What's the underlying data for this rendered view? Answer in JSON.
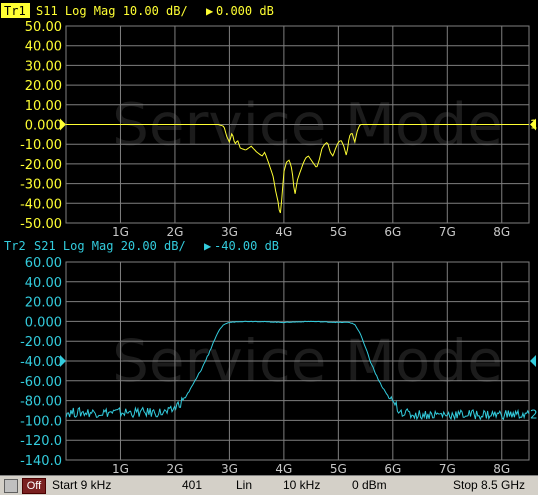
{
  "colors": {
    "trace1": "#ffff33",
    "trace2": "#33ccdd",
    "grid": "#7f7f7f",
    "background": "#000000",
    "watermark": "#1c1c1c"
  },
  "trace1": {
    "tag": "Tr1",
    "label": "S11 Log Mag 10.00 dB/",
    "ref_marker": "▶",
    "ref_value": "0.000 dB",
    "marker_end": "1"
  },
  "trace2": {
    "tag": "Tr2",
    "label": "S21 Log Mag 20.00 dB/",
    "ref_marker": "▶",
    "ref_value": "-40.00 dB",
    "marker_end": "2"
  },
  "watermark": "Service Mode",
  "status": {
    "square_icon": "square-icon",
    "off": "Off",
    "start": "Start 9 kHz",
    "points": "401",
    "sweep_type": "Lin",
    "ifbw": "10 kHz",
    "power": "0 dBm",
    "stop": "Stop 8.5 GHz"
  },
  "chart_data": [
    {
      "type": "line",
      "title": "S11 Log Mag 10.00 dB/",
      "xlabel": "",
      "ylabel": "",
      "x_unit": "GHz",
      "xlim": [
        0,
        8.5
      ],
      "ylim": [
        -50,
        50
      ],
      "yticks": [
        50,
        40,
        30,
        20,
        10,
        0,
        -10,
        -20,
        -30,
        -40,
        -50
      ],
      "ytick_labels": [
        "50.00",
        "40.00",
        "30.00",
        "20.00",
        "10.00",
        "0.000",
        "-10.00",
        "-20.00",
        "-30.00",
        "-40.00",
        "-50.00"
      ],
      "xtick_labels": [
        "1G",
        "2G",
        "3G",
        "4G",
        "5G",
        "6G",
        "7G",
        "8G"
      ],
      "grid": true,
      "series": [
        {
          "x": [
            0,
            2.7,
            2.8,
            2.9,
            2.95,
            3.0,
            3.05,
            3.1,
            3.15,
            3.2,
            3.3,
            3.4,
            3.5,
            3.6,
            3.65,
            3.7,
            3.75,
            3.8,
            3.85,
            3.9,
            3.93,
            3.96,
            4.0,
            4.05,
            4.1,
            4.15,
            4.2,
            4.25,
            4.3,
            4.35,
            4.4,
            4.45,
            4.5,
            4.55,
            4.6,
            4.65,
            4.7,
            4.75,
            4.8,
            4.85,
            4.9,
            4.95,
            5.0,
            5.05,
            5.1,
            5.15,
            5.2,
            5.25,
            5.3,
            5.35,
            5.4,
            8.5
          ],
          "values": [
            0,
            0,
            0,
            -1,
            -6,
            -9,
            -4,
            -10,
            -8,
            -12,
            -13,
            -11,
            -14,
            -16,
            -14,
            -18,
            -22,
            -26,
            -34,
            -40,
            -47,
            -38,
            -24,
            -19,
            -18,
            -23,
            -36,
            -28,
            -24,
            -20,
            -17,
            -16,
            -18,
            -20,
            -22,
            -18,
            -12,
            -10,
            -9,
            -14,
            -16,
            -12,
            -9,
            -8,
            -11,
            -16,
            -6,
            -4,
            -9,
            -3,
            0,
            0
          ]
        }
      ]
    },
    {
      "type": "line",
      "title": "S21 Log Mag 20.00 dB/",
      "xlabel": "",
      "ylabel": "",
      "x_unit": "GHz",
      "xlim": [
        0,
        8.5
      ],
      "ylim": [
        -140,
        60
      ],
      "yticks": [
        60,
        40,
        20,
        0,
        -20,
        -40,
        -60,
        -80,
        -100,
        -120,
        -140
      ],
      "ytick_labels": [
        "60.00",
        "40.00",
        "20.00",
        "0.000",
        "-20.00",
        "-40.00",
        "-60.00",
        "-80.00",
        "-100.0",
        "-120.0",
        "-140.0"
      ],
      "xtick_labels": [
        "1G",
        "2G",
        "3G",
        "4G",
        "5G",
        "6G",
        "7G",
        "8G"
      ],
      "grid": true,
      "series": [
        {
          "x": [
            0,
            1.9,
            2.0,
            2.1,
            2.2,
            2.3,
            2.4,
            2.5,
            2.6,
            2.7,
            2.8,
            2.9,
            3.0,
            3.2,
            3.5,
            4.0,
            4.5,
            5.0,
            5.2,
            5.3,
            5.4,
            5.5,
            5.6,
            5.7,
            5.8,
            5.9,
            6.0,
            6.1,
            6.2,
            6.3,
            8.5
          ],
          "values": [
            -92,
            -92,
            -87,
            -82,
            -76,
            -67,
            -57,
            -47,
            -35,
            -22,
            -10,
            -3,
            -1,
            0,
            0,
            -1,
            0,
            -1,
            -1,
            -3,
            -12,
            -27,
            -42,
            -55,
            -66,
            -75,
            -82,
            -88,
            -92,
            -94,
            -94
          ]
        }
      ]
    }
  ]
}
